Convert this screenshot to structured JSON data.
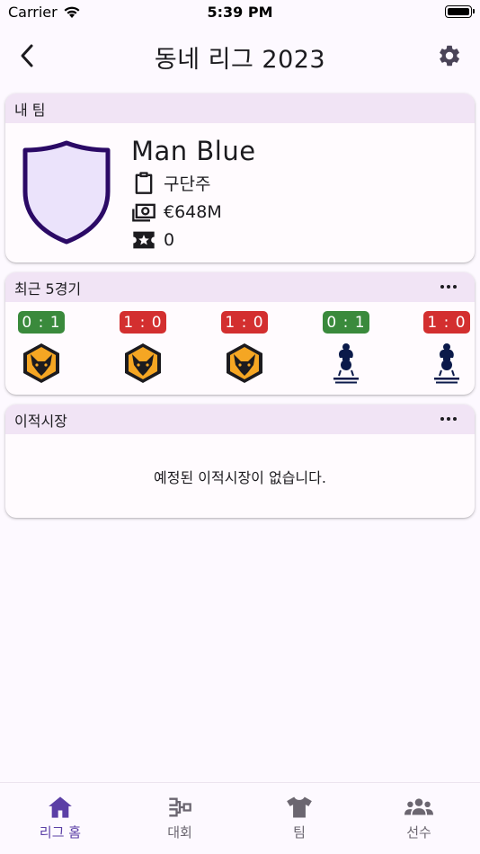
{
  "status_bar": {
    "carrier": "Carrier",
    "time": "5:39 PM"
  },
  "app_bar": {
    "title": "동네 리그 2023"
  },
  "my_team": {
    "header": "내 팀",
    "name": "Man Blue",
    "manager": "구단주",
    "budget": "€648M",
    "trophies": "0"
  },
  "recent_matches": {
    "header": "최근 5경기",
    "matches": [
      {
        "score": "0 : 1",
        "result": "win",
        "opponent_icon": "wolf-crest-icon"
      },
      {
        "score": "1 : 0",
        "result": "loss",
        "opponent_icon": "wolf-crest-icon"
      },
      {
        "score": "1 : 0",
        "result": "loss",
        "opponent_icon": "wolf-crest-icon"
      },
      {
        "score": "0 : 1",
        "result": "win",
        "opponent_icon": "cockerel-crest-icon"
      },
      {
        "score": "1 : 0",
        "result": "loss",
        "opponent_icon": "cockerel-crest-icon"
      }
    ]
  },
  "transfer": {
    "header": "이적시장",
    "empty_message": "예정된 이적시장이 없습니다."
  },
  "bottom_nav": {
    "items": [
      {
        "label": "리그 홈",
        "icon": "home-icon",
        "active": true
      },
      {
        "label": "대회",
        "icon": "bracket-icon",
        "active": false
      },
      {
        "label": "팀",
        "icon": "jersey-icon",
        "active": false
      },
      {
        "label": "선수",
        "icon": "people-icon",
        "active": false
      }
    ]
  },
  "colors": {
    "accent": "#5b3fa6",
    "win": "#3a8a3c",
    "loss": "#d32f2f",
    "card_header": "#f1e4f5",
    "crest_fill": "#ebe3fb",
    "crest_stroke": "#2b0a66"
  }
}
